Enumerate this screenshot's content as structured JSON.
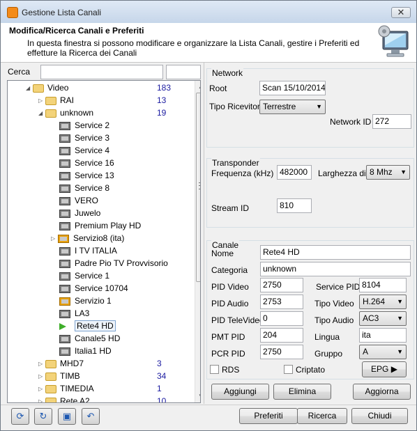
{
  "window": {
    "title": "Gestione Lista Canali",
    "close_glyph": "✕"
  },
  "header": {
    "title": "Modifica/Ricerca Canali e Preferiti",
    "description": "In questa finestra si possono modificare e organizzare la Lista Canali, gestire i Preferiti ed effetture la Ricerca dei Canali",
    "icon": "monitor-settings-icon"
  },
  "search": {
    "label": "Cerca",
    "value": "",
    "value2": ""
  },
  "tree": {
    "root": {
      "label": "Video",
      "count": "183"
    },
    "rai": {
      "label": "RAI",
      "count": "13"
    },
    "unknown": {
      "label": "unknown",
      "count": "19"
    },
    "channels": [
      {
        "label": "Service 2",
        "icon": "channel-icon"
      },
      {
        "label": "Service 3",
        "icon": "channel-icon"
      },
      {
        "label": "Service 4",
        "icon": "channel-icon"
      },
      {
        "label": "Service 16",
        "icon": "channel-icon"
      },
      {
        "label": "Service 13",
        "icon": "channel-icon"
      },
      {
        "label": "Service 8",
        "icon": "channel-icon"
      },
      {
        "label": "VERO",
        "icon": "channel-icon"
      },
      {
        "label": "Juwelo",
        "icon": "channel-icon"
      },
      {
        "label": "Premium Play HD",
        "icon": "channel-icon"
      },
      {
        "label": "Servizio8 (ita)",
        "icon": "channel-warning-icon"
      },
      {
        "label": "I TV ITALIA",
        "icon": "channel-icon"
      },
      {
        "label": "Padre Pio TV Provvisorio",
        "icon": "channel-icon"
      },
      {
        "label": "Service 1",
        "icon": "channel-icon"
      },
      {
        "label": "Service 10704",
        "icon": "channel-icon"
      },
      {
        "label": "Servizio 1",
        "icon": "channel-warning-icon"
      },
      {
        "label": "LA3",
        "icon": "channel-icon"
      },
      {
        "label": "Rete4 HD",
        "icon": "selected-arrow-icon"
      },
      {
        "label": "Canale5 HD",
        "icon": "channel-icon"
      },
      {
        "label": "Italia1 HD",
        "icon": "channel-icon"
      }
    ],
    "groups": [
      {
        "label": "MHD7",
        "count": "3"
      },
      {
        "label": "TIMB",
        "count": "34"
      },
      {
        "label": "TIMEDIA",
        "count": "1"
      },
      {
        "label": "Rete A2",
        "count": "10"
      }
    ]
  },
  "network": {
    "group_label": "Network",
    "root_label": "Root",
    "root_value": "Scan 15/10/2014",
    "receiver_label": "Tipo Ricevitore",
    "receiver_value": "Terrestre",
    "network_id_label": "Network ID",
    "network_id_value": "272"
  },
  "transponder": {
    "group_label": "Transponder",
    "freq_label": "Frequenza (kHz)",
    "freq_value": "482000",
    "bandwidth_label": "Larghezza di B",
    "bandwidth_value": "8 Mhz",
    "stream_label": "Stream ID",
    "stream_value": "810"
  },
  "canale": {
    "group_label": "Canale",
    "name_label": "Nome",
    "name_value": "Rete4 HD",
    "category_label": "Categoria",
    "category_value": "unknown",
    "pid_video_label": "PID Video",
    "pid_video_value": "2750",
    "service_pid_label": "Service PID",
    "service_pid_value": "8104",
    "pid_audio_label": "PID Audio",
    "pid_audio_value": "2753",
    "tipo_video_label": "Tipo Video",
    "tipo_video_value": "H.264",
    "pid_tele_label": "PID TeleVideo",
    "pid_tele_value": "0",
    "tipo_audio_label": "Tipo Audio",
    "tipo_audio_value": "AC3",
    "pmt_label": "PMT PID",
    "pmt_value": "204",
    "lingua_label": "Lingua",
    "lingua_value": "ita",
    "pcr_label": "PCR PID",
    "pcr_value": "2750",
    "gruppo_label": "Gruppo",
    "gruppo_value": "A",
    "rds_label": "RDS",
    "criptato_label": "Criptato",
    "epg_label": "EPG"
  },
  "actions": {
    "add": "Aggiungi",
    "delete": "Elimina",
    "update": "Aggiorna"
  },
  "footer": {
    "preferiti": "Preferiti",
    "ricerca": "Ricerca",
    "chiudi": "Chiudi"
  }
}
